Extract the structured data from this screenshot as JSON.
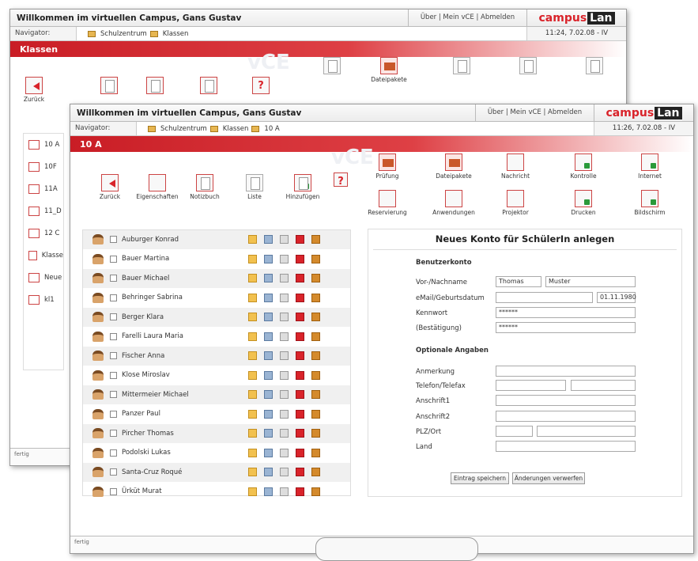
{
  "app": {
    "welcome_title": "Willkommen im virtuellen Campus, Gans Gustav",
    "top_links": "Über | Mein vCE | Abmelden",
    "logo_part1": "campus",
    "logo_part2": "Lan",
    "navigator_label": "Navigator:"
  },
  "back_window": {
    "breadcrumb": [
      "Schulzentrum",
      "Klassen"
    ],
    "time": "11:24, 7.02.08 - IV",
    "section_title": "Klassen",
    "toolbar": {
      "back": "Zurück",
      "file_packages": "Dateipakete"
    },
    "groups": [
      "10 A",
      "10F",
      "11A",
      "11_D",
      "12 C",
      "Klasse",
      "Neue",
      "kl1"
    ],
    "status": "fertig"
  },
  "front_window": {
    "breadcrumb": [
      "Schulzentrum",
      "Klassen",
      "10 A"
    ],
    "time": "11:26, 7.02.08 - IV",
    "section_title": "10 A",
    "toolbar_left": [
      "Zurück",
      "Eigenschaften",
      "Notizbuch",
      "Liste",
      "Hinzufügen"
    ],
    "toolbar_right_row1": [
      "Prüfung",
      "Dateipakete",
      "Nachricht",
      "Kontrolle",
      "Internet"
    ],
    "toolbar_right_row2": [
      "Reservierung",
      "Anwendungen",
      "Projektor",
      "Drucken",
      "Bildschirm"
    ],
    "students": [
      "Auburger Konrad",
      "Bauer Martina",
      "Bauer Michael",
      "Behringer Sabrina",
      "Berger Klara",
      "Farelli Laura Maria",
      "Fischer Anna",
      "Klose Miroslav",
      "Mittermeier Michael",
      "Panzer Paul",
      "Pircher Thomas",
      "Podolski Lukas",
      "Santa-Cruz Roqué",
      "Ürküt Murat"
    ],
    "form": {
      "title": "Neues Konto für SchülerIn anlegen",
      "section_account": "Benutzerkonto",
      "label_name": "Vor-/Nachname",
      "value_first_name": "Thomas",
      "value_last_name": "Muster",
      "label_email_birth": "eMail/Geburtsdatum",
      "value_email": "",
      "value_birth": "01.11.1980",
      "label_password": "Kennwort",
      "value_password": "******",
      "label_confirm": "(Bestätigung)",
      "value_confirm": "******",
      "section_optional": "Optionale Angaben",
      "label_note": "Anmerkung",
      "label_phone": "Telefon/Telefax",
      "label_address1": "Anschrift1",
      "label_address2": "Anschrift2",
      "label_zip_city": "PLZ/Ort",
      "label_country": "Land",
      "save_button": "Eintrag speichern",
      "discard_button": "Änderungen verwerfen"
    },
    "status": "fertig"
  }
}
